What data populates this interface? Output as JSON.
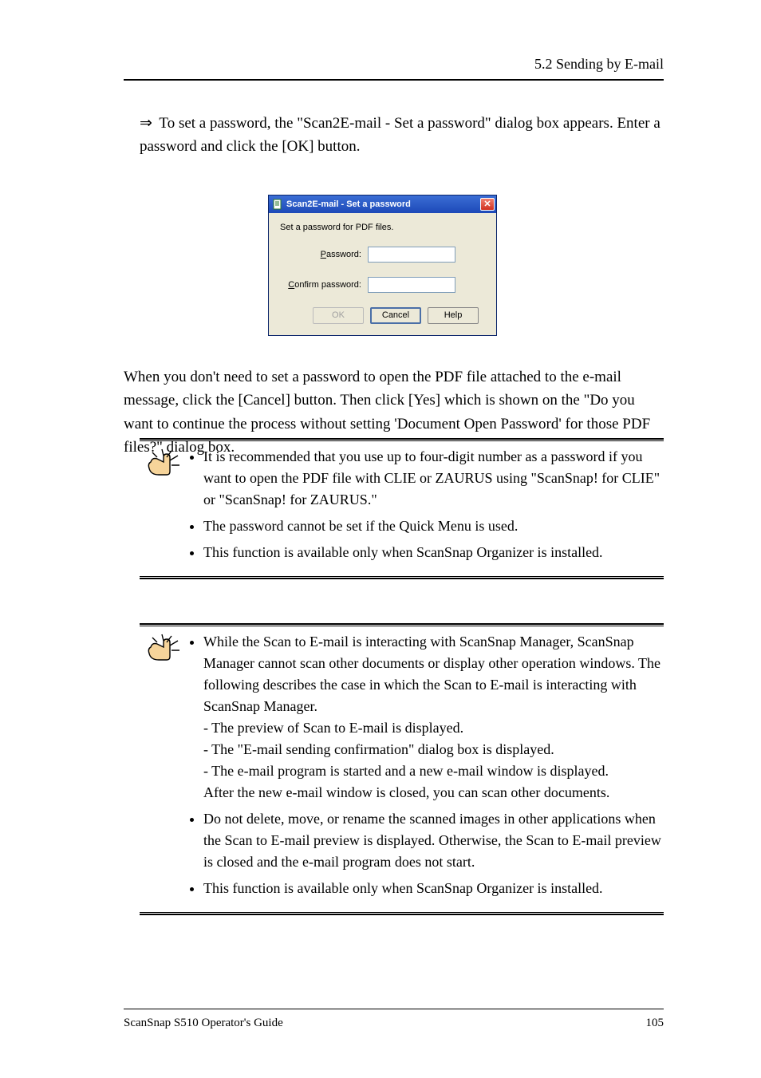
{
  "header": {
    "section": "5.2 Sending by E-mail"
  },
  "lead": {
    "arrow": "⇒",
    "text": "To set a password, the \"Scan2E-mail - Set a password\" dialog box appears. Enter a password and click the [OK] button."
  },
  "dialog": {
    "title": "Scan2E-mail - Set a password",
    "instruction": "Set a password for PDF files.",
    "password_label_ul": "P",
    "password_label_rest": "assword:",
    "confirm_label_ul": "C",
    "confirm_label_rest": "onfirm password:",
    "password_value": "",
    "confirm_value": "",
    "ok": "OK",
    "cancel": "Cancel",
    "help": "Help",
    "close_icon": "✕"
  },
  "para1": "When you don't need to set a password to open the PDF file attached to the e-mail message, click the [Cancel] button. Then click [Yes] which is shown on the \"Do you want to continue the process without setting 'Document Open Password' for those PDF files?\" dialog box.",
  "note1": {
    "items": [
      "It is recommended that you use up to four-digit number as a password if you want to open the PDF file with CLIE or ZAURUS using \"ScanSnap! for CLIE\" or \"ScanSnap! for ZAURUS.\"",
      "The password cannot be set if the Quick Menu is used.",
      "This function is available only when ScanSnap Organizer is installed."
    ]
  },
  "note2": {
    "items": [
      "While the Scan to E-mail is interacting with ScanSnap Manager, ScanSnap Manager cannot scan other documents or display other operation windows. The following describes the case in which the Scan to E-mail is interacting with ScanSnap Manager.\n- The preview of Scan to E-mail is displayed.\n- The \"E-mail sending confirmation\" dialog box is displayed.\n- The e-mail program is started and a new e-mail window is displayed.\nAfter the new e-mail window is closed, you can scan other documents.",
      "Do not delete, move, or rename the scanned images in other applications when the Scan to E-mail preview is displayed. Otherwise, the Scan to E-mail preview is closed and the e-mail program does not start.",
      "This function is available only when ScanSnap Organizer is installed."
    ]
  },
  "footer": {
    "left": "ScanSnap S510 Operator's Guide",
    "right": "105"
  },
  "icons": {
    "finger": "pointing-finger-icon",
    "doc": "document-icon"
  }
}
